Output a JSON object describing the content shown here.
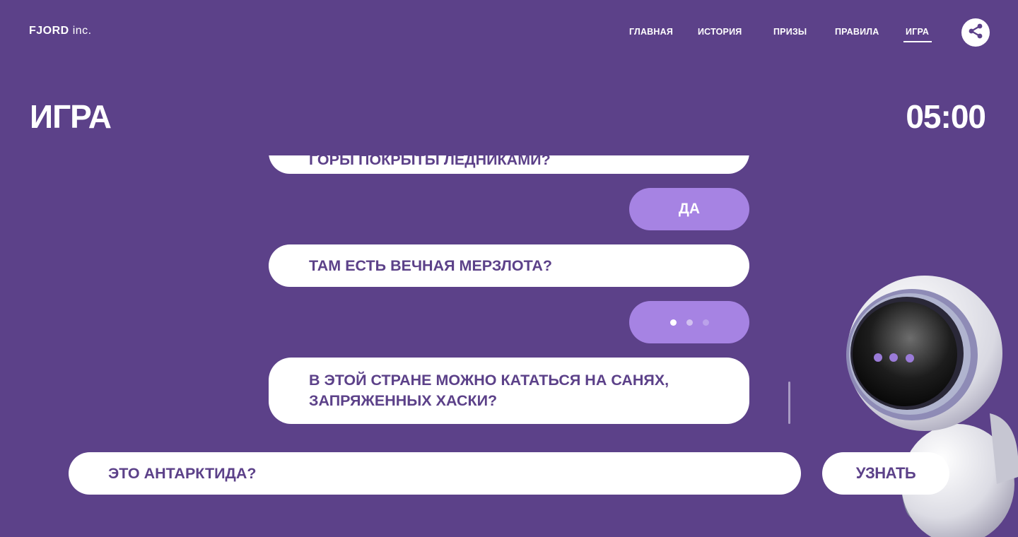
{
  "header": {
    "logo_main": "FJORD",
    "logo_suffix": "inc.",
    "nav": [
      "ГЛАВНАЯ",
      "ИСТОРИЯ",
      "ПРИЗЫ",
      "ПРАВИЛА",
      "ИГРА"
    ],
    "active_nav": "ИГРА",
    "share_icon": "share-icon"
  },
  "page": {
    "title": "ИГРА",
    "timer": "05:00"
  },
  "chat": {
    "messages": [
      {
        "type": "question",
        "text": "ГОРЫ ПОКРЫТЫ ЛЕДНИКАМИ?",
        "partially_visible": true
      },
      {
        "type": "answer",
        "text": "ДА"
      },
      {
        "type": "question",
        "text": "ТАМ ЕСТЬ ВЕЧНАЯ МЕРЗЛОТА?"
      },
      {
        "type": "typing",
        "text": ""
      },
      {
        "type": "question",
        "text": "В ЭТОЙ СТРАНЕ МОЖНО КАТАТЬСЯ НА САНЯХ, ЗАПРЯЖЕННЫХ ХАСКИ?"
      }
    ]
  },
  "input": {
    "value": "ЭТО АНТАРКТИДА?",
    "placeholder": ""
  },
  "submit_label": "УЗНАТЬ",
  "colors": {
    "background": "#5c4189",
    "answer_bubble": "#a683e3",
    "text_dark": "#5c4189",
    "white": "#ffffff"
  }
}
